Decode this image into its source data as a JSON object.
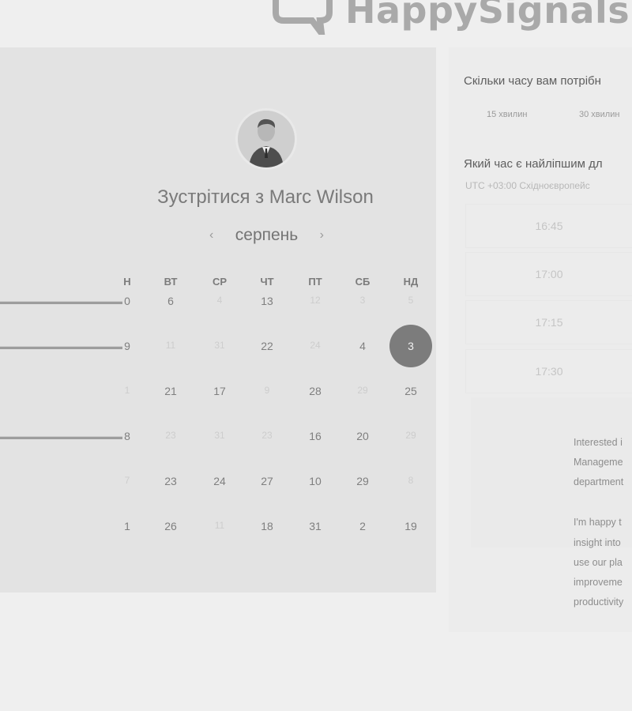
{
  "brand": {
    "name": "HappySignals"
  },
  "calendar": {
    "title": "Зустрітися з Marc Wilson",
    "month": "серпень",
    "prev_icon": "chevron-left-icon",
    "next_icon": "chevron-right-icon",
    "weekdays": [
      "Н",
      "ВТ",
      "СР",
      "ЧТ",
      "ПТ",
      "СБ",
      "НД"
    ],
    "weeks": [
      [
        "0",
        "6",
        "4",
        "13",
        "12",
        "3",
        "5"
      ],
      [
        "9",
        "11",
        "31",
        "22",
        "24",
        "4",
        "3"
      ],
      [
        "1",
        "21",
        "17",
        "9",
        "28",
        "29",
        "25"
      ],
      [
        "8",
        "23",
        "31",
        "23",
        "16",
        "20",
        "29"
      ],
      [
        "7",
        "23",
        "24",
        "27",
        "10",
        "29",
        "8"
      ],
      [
        "1",
        "26",
        "11",
        "18",
        "31",
        "2",
        "19"
      ]
    ],
    "faded": [
      [
        false,
        false,
        true,
        false,
        true,
        true,
        true
      ],
      [
        false,
        true,
        true,
        false,
        true,
        false,
        false
      ],
      [
        true,
        false,
        false,
        true,
        false,
        true,
        false
      ],
      [
        false,
        true,
        true,
        true,
        false,
        false,
        true
      ],
      [
        true,
        false,
        false,
        false,
        false,
        false,
        true
      ],
      [
        false,
        false,
        true,
        false,
        false,
        false,
        false
      ]
    ],
    "selected": {
      "week": 1,
      "day": 6
    }
  },
  "duration": {
    "question": "Скільки часу вам потрібн",
    "options": [
      "15 хвилин",
      "30 хвилин"
    ]
  },
  "time": {
    "question": "Який час є найліпшим дл",
    "timezone": "UTC +03:00 Східноєвропейс",
    "slots": [
      "16:45",
      "17:00",
      "17:15",
      "17:30"
    ]
  },
  "info": {
    "lines": [
      "Interested i",
      "Manageme",
      "department"
    ],
    "lines2": [
      "I'm happy t",
      "insight into",
      "use our pla",
      "improveme",
      "productivity"
    ]
  },
  "colors": {
    "accent": "#7c7c7c",
    "panel": "#e3e3e3",
    "background": "#efefef"
  }
}
